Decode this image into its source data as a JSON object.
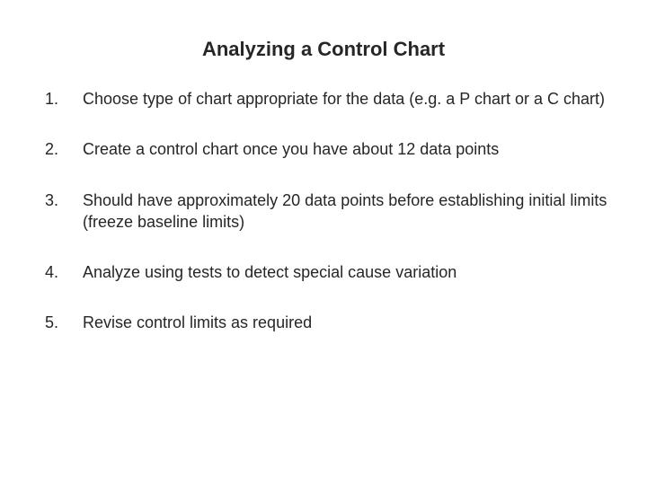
{
  "title": "Analyzing a Control Chart",
  "steps": [
    "Choose type of chart appropriate for the data (e.g. a P chart or a C chart)",
    "Create a control chart once you have about 12 data points",
    "Should have approximately 20 data points before establishing initial limits (freeze baseline limits)",
    "Analyze using tests to detect special cause variation",
    "Revise control limits as required"
  ]
}
